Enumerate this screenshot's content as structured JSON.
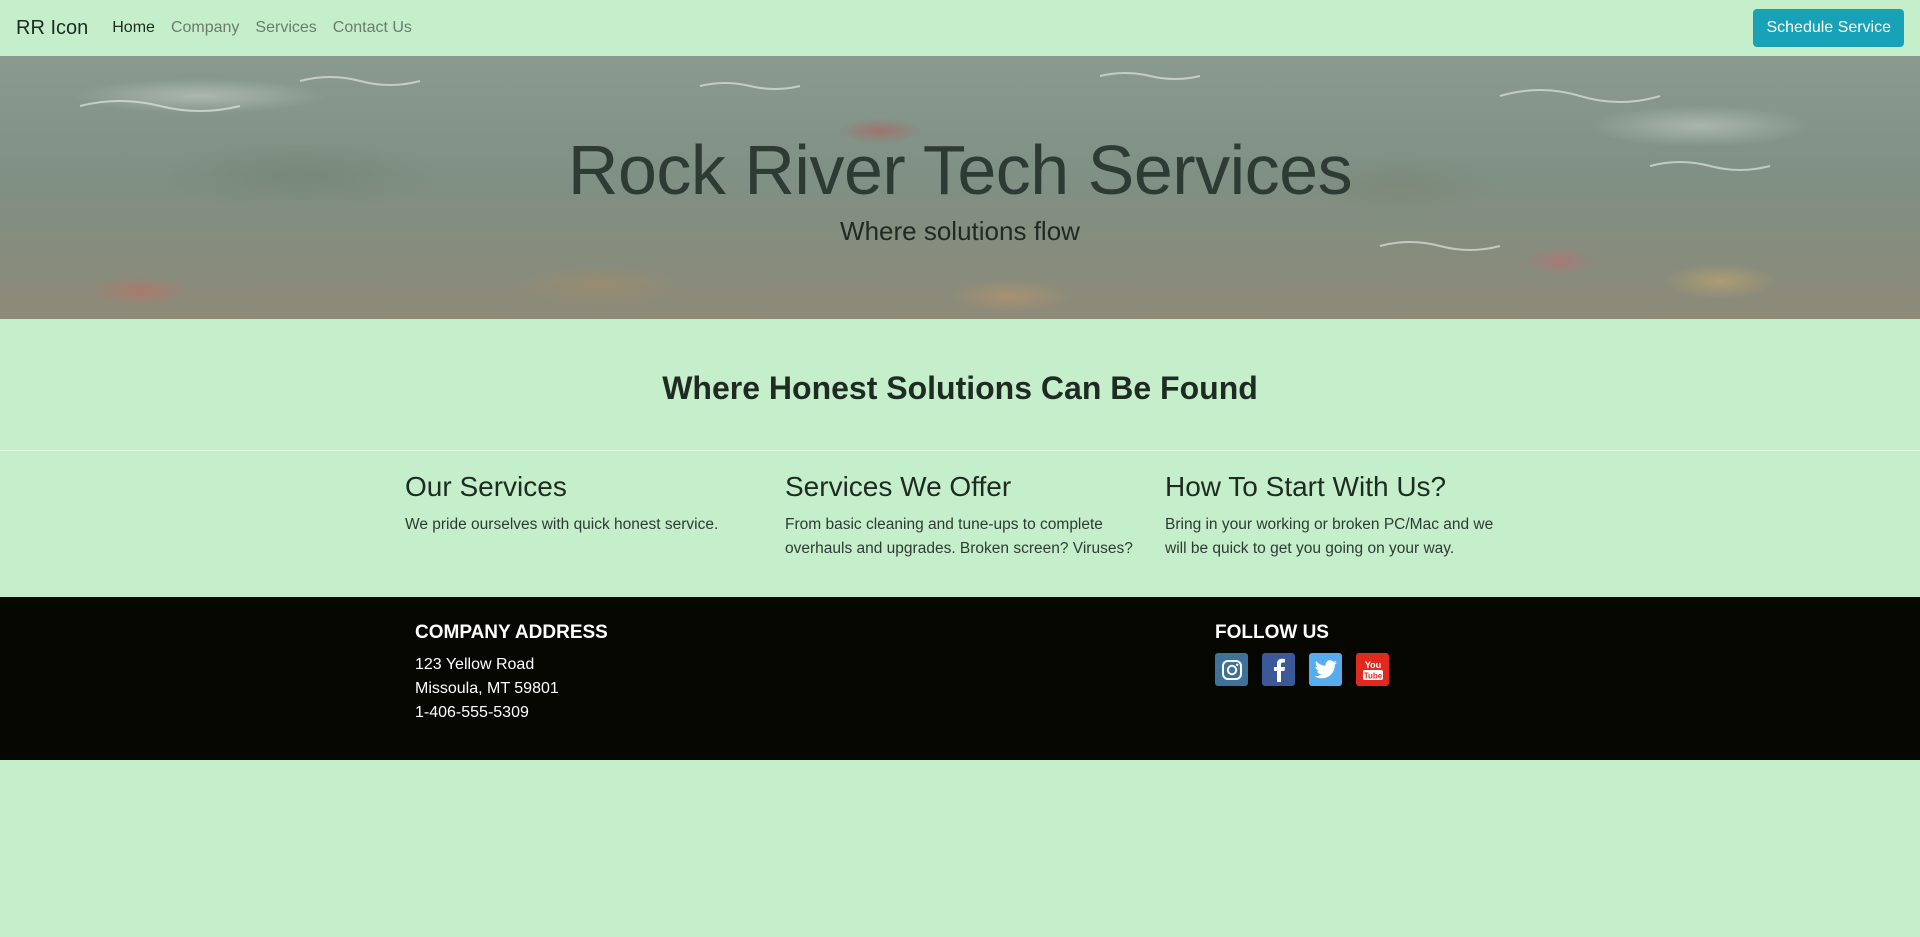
{
  "navbar": {
    "brand": "RR Icon",
    "links": [
      "Home",
      "Company",
      "Services",
      "Contact Us"
    ],
    "cta": "Schedule Service"
  },
  "hero": {
    "title": "Rock River Tech Services",
    "subtitle": "Where solutions flow"
  },
  "tagline": "Where Honest Solutions Can Be Found",
  "columns": [
    {
      "heading": "Our Services",
      "text": "We pride ourselves with quick honest service."
    },
    {
      "heading": "Services We Offer",
      "text": "From basic cleaning and tune-ups to complete overhauls and upgrades. Broken screen? Viruses?"
    },
    {
      "heading": "How To Start With Us?",
      "text": "Bring in your working or broken PC/Mac and we will be quick to get you going on your way."
    }
  ],
  "footer": {
    "address_heading": "COMPANY ADDRESS",
    "address_lines": [
      "123 Yellow Road",
      "Missoula, MT 59801",
      "1-406-555-5309"
    ],
    "follow_heading": "FOLLOW US",
    "social_icons": [
      "instagram-icon",
      "facebook-icon",
      "twitter-icon",
      "youtube-icon"
    ]
  },
  "colors": {
    "page_bg": "#c5efcb",
    "cta_bg": "#17a2b8",
    "footer_bg": "#070702"
  }
}
